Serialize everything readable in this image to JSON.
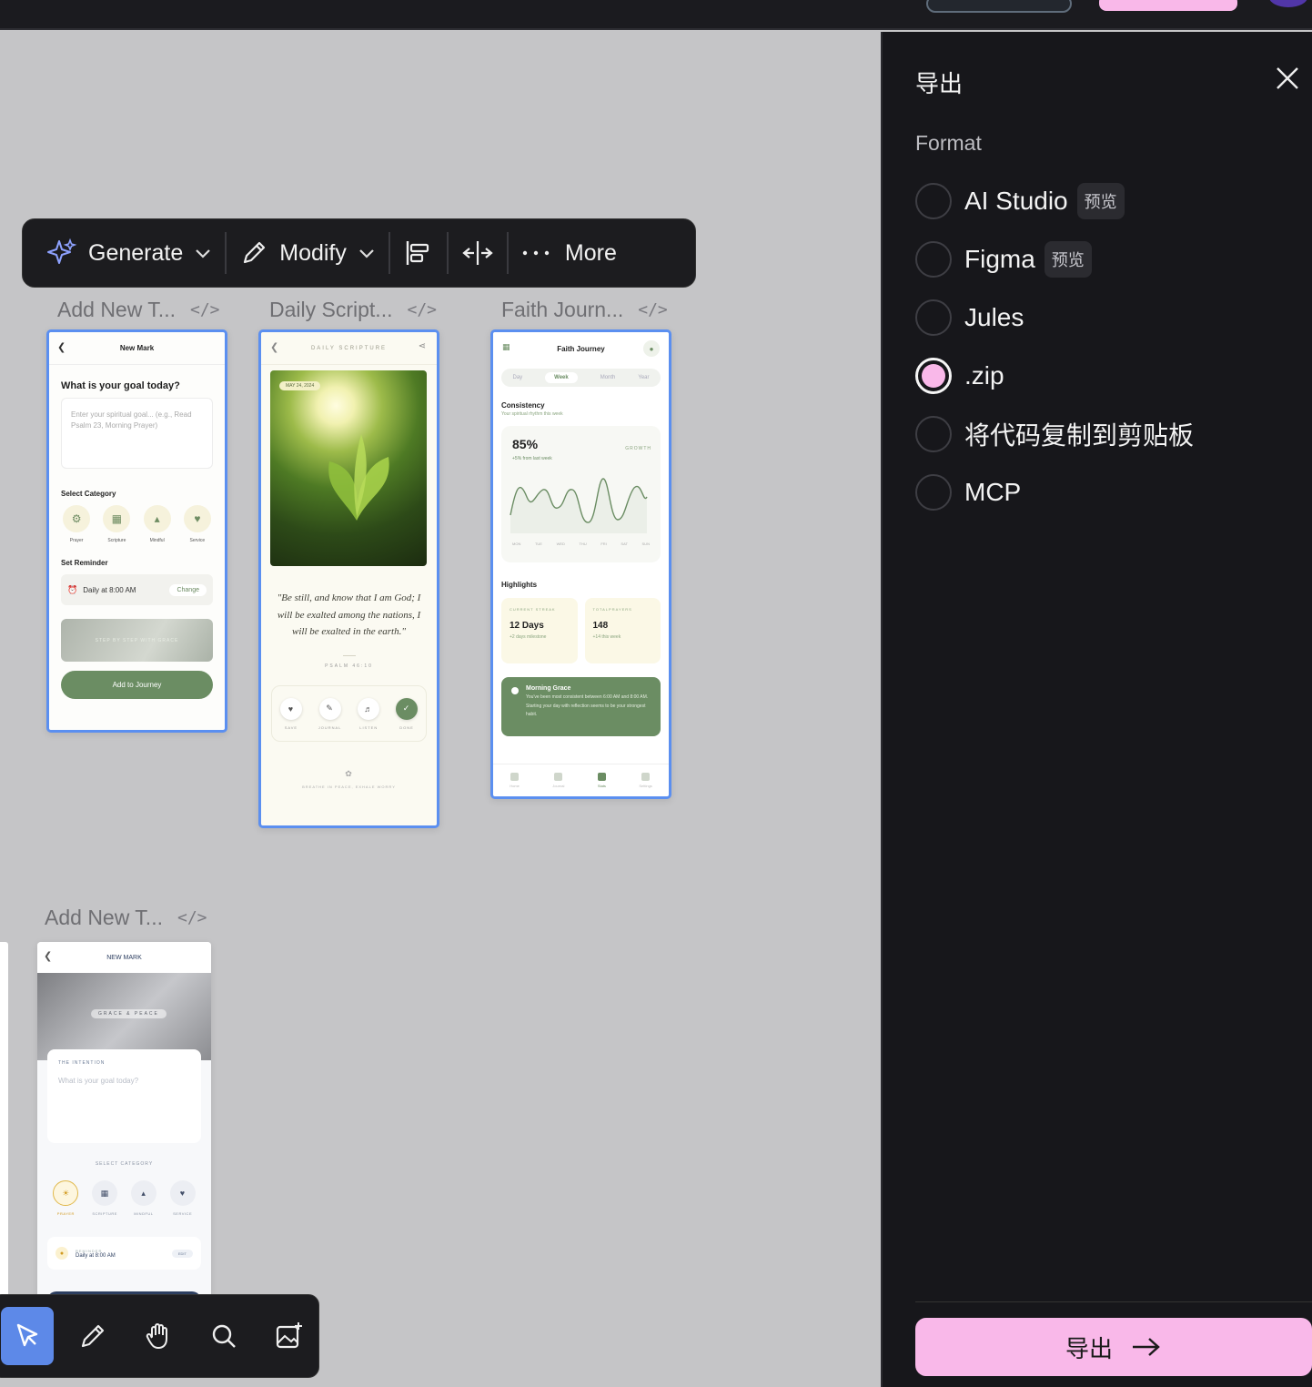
{
  "toolbar": {
    "generate": "Generate",
    "modify": "Modify",
    "more": "More"
  },
  "frames": [
    {
      "label": "Add New T...",
      "code": "</>"
    },
    {
      "label": "Daily Script...",
      "code": "</>"
    },
    {
      "label": "Faith Journ...",
      "code": "</>"
    },
    {
      "label": "Add New T...",
      "code": "</>"
    }
  ],
  "screen1": {
    "title": "New Mark",
    "question": "What is your goal today?",
    "placeholder": "Enter your spiritual goal... (e.g., Read Psalm 23, Morning Prayer)",
    "select_category": "Select Category",
    "categories": [
      "Prayer",
      "Scripture",
      "Mindful",
      "Service"
    ],
    "set_reminder": "Set Reminder",
    "reminder_value": "Daily at 8:00 AM",
    "change": "Change",
    "banner": "STEP BY STEP WITH GRACE",
    "button": "Add to Journey"
  },
  "screen2": {
    "title": "DAILY SCRIPTURE",
    "date": "MAY 24, 2024",
    "quote": "\"Be still, and know that I am God; I will be exalted among the nations, I will be exalted in the earth.\"",
    "reference": "PSALM 46:10",
    "actions": [
      "SAVE",
      "JOURNAL",
      "LISTEN",
      "DONE"
    ],
    "footer": "BREATHE IN PEACE, EXHALE WORRY"
  },
  "screen3": {
    "title": "Faith Journey",
    "tabs": [
      "Day",
      "Week",
      "Month",
      "Year"
    ],
    "active_tab": "Week",
    "consistency": "Consistency",
    "consistency_sub": "Your spiritual rhythm this week",
    "percent": "85%",
    "change": "+5% from last week",
    "growth": "GROWTH",
    "days": [
      "MON",
      "TUE",
      "WED",
      "THU",
      "FRI",
      "SAT",
      "SUN"
    ],
    "highlights": "Highlights",
    "card1_label": "CURRENT STREAK",
    "card1_value": "12 Days",
    "card1_sub": "+2 days milestone",
    "card2_label": "TOTALPRAYERS",
    "card2_value": "148",
    "card2_sub": "+14 this week",
    "insight_title": "Morning Grace",
    "insight_text": "You've been most consistent between 6:00 AM and 8:00 AM. Starting your day with reflection seems to be your strongest habit.",
    "nav": [
      "Home",
      "Journal",
      "Stats",
      "Settings"
    ]
  },
  "screen4": {
    "title": "NEW MARK",
    "badge": "GRACE & PEACE",
    "intention_label": "THE INTENTION",
    "intention_placeholder": "What is your goal today?",
    "select_category": "SELECT CATEGORY",
    "categories": [
      "PRAYER",
      "SCRIPTURE",
      "MINDFUL",
      "SERVICE"
    ],
    "reminder_label": "REMINDER",
    "reminder_value": "Daily at 8:00 AM",
    "edit": "EDIT"
  },
  "panel": {
    "title": "导出",
    "format_label": "Format",
    "options": [
      {
        "label": "AI Studio",
        "tag": "预览"
      },
      {
        "label": "Figma",
        "tag": "预览"
      },
      {
        "label": "Jules"
      },
      {
        "label": ".zip"
      },
      {
        "label": "将代码复制到剪贴板"
      },
      {
        "label": "MCP"
      }
    ],
    "selected": ".zip",
    "export_button": "导出"
  },
  "colors": {
    "accent_pink": "#f9b8e9",
    "selection_blue": "#5b8ff0",
    "panel_bg": "#17171b",
    "canvas_bg": "#c5c5c7",
    "sage_green": "#6b8d63"
  }
}
